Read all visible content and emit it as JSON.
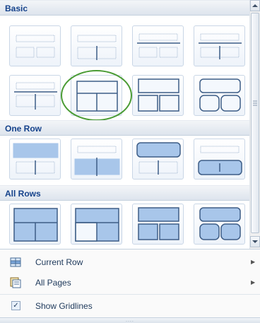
{
  "sections": {
    "basic": "Basic",
    "one_row": "One Row",
    "all_rows": "All Rows"
  },
  "tiles": [
    {
      "id": "basic-1",
      "icon": "layout-two-cells-empty"
    },
    {
      "id": "basic-2",
      "icon": "layout-header-split"
    },
    {
      "id": "basic-3",
      "icon": "layout-header-line-two-cells"
    },
    {
      "id": "basic-4",
      "icon": "layout-header-line-split"
    },
    {
      "id": "basic-5",
      "icon": "layout-top-line-split"
    },
    {
      "id": "basic-6",
      "icon": "layout-split-bottom-selected"
    },
    {
      "id": "basic-7",
      "icon": "layout-box-over-two"
    },
    {
      "id": "basic-8",
      "icon": "layout-rounded-over-two"
    },
    {
      "id": "onerow-1",
      "icon": "layout-filled-top-row"
    },
    {
      "id": "onerow-2",
      "icon": "layout-filled-bottom-row"
    },
    {
      "id": "onerow-3",
      "icon": "layout-rounded-top-row"
    },
    {
      "id": "onerow-4",
      "icon": "layout-rounded-bottom-row"
    },
    {
      "id": "allrows-1",
      "icon": "layout-all-filled-split"
    },
    {
      "id": "allrows-2",
      "icon": "layout-all-filled-half"
    },
    {
      "id": "allrows-3",
      "icon": "layout-all-box-over-two"
    },
    {
      "id": "allrows-4",
      "icon": "layout-all-rounded-over-two"
    }
  ],
  "menu": {
    "current_row": "Current Row",
    "all_pages": "All Pages",
    "show_gridlines": "Show Gridlines",
    "show_gridlines_checked": true
  },
  "colors": {
    "accent": "#15428b",
    "tile_fill": "#a8c6ea",
    "highlight": "#4a9b34"
  }
}
